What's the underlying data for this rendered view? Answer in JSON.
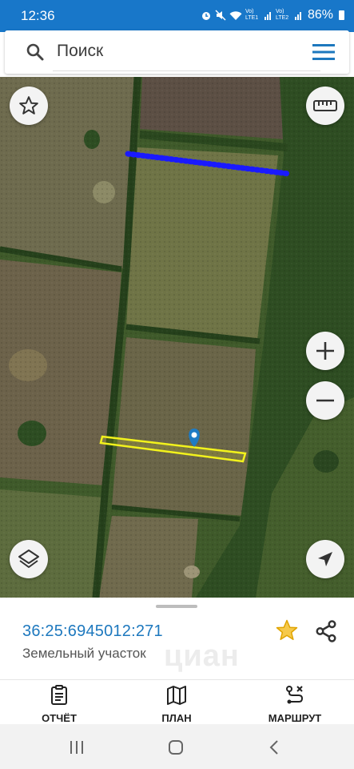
{
  "status": {
    "time": "12:36",
    "sim1": "Vo) LTE1",
    "sim2": "Vo) LTE2",
    "battery": "86%"
  },
  "search": {
    "placeholder": "Поиск"
  },
  "parcel": {
    "cadastral_number": "36:25:6945012:271",
    "type": "Земельный участок",
    "watermark": "циан"
  },
  "bottom_nav": [
    {
      "label": "ОТЧЁТ",
      "icon": "report-clipboard-icon"
    },
    {
      "label": "ПЛАН",
      "icon": "map-plan-icon"
    },
    {
      "label": "МАРШРУТ",
      "icon": "route-icon"
    }
  ],
  "colors": {
    "status_bar": "#1877c9",
    "accent": "#1d78be",
    "parcel_outline": "#f2f21c",
    "route_dots": "#1a1aff",
    "star": "#f0b400"
  }
}
